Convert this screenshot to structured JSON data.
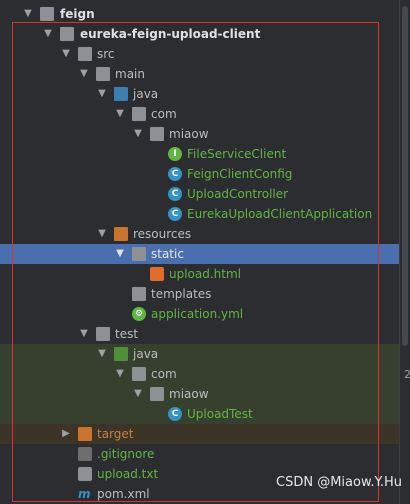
{
  "tree": {
    "root": "feign",
    "module": "eureka-feign-upload-client",
    "src": "src",
    "main": "main",
    "java": "java",
    "com": "com",
    "miaow": "miaow",
    "files": [
      {
        "label": "FileServiceClient",
        "kind": "interface"
      },
      {
        "label": "FeignClientConfig",
        "kind": "class"
      },
      {
        "label": "UploadController",
        "kind": "class"
      },
      {
        "label": "EurekaUploadClientApplication",
        "kind": "app"
      }
    ],
    "resources": "resources",
    "static": "static",
    "upload_html": "upload.html",
    "templates": "templates",
    "application_yml": "application.yml",
    "test": "test",
    "test_java": "java",
    "test_com": "com",
    "test_miaow": "miaow",
    "upload_test": "UploadTest",
    "target": "target",
    "gitignore": ".gitignore",
    "upload_txt": "upload.txt",
    "pom_xml": "pom.xml"
  },
  "colors": {
    "selection": "#4b6eaf",
    "border": "#d9342b",
    "green_text": "#62b543",
    "orange_text": "#c77f3f"
  },
  "gutter": "2",
  "watermark": "CSDN @Miaow.Y.Hu"
}
